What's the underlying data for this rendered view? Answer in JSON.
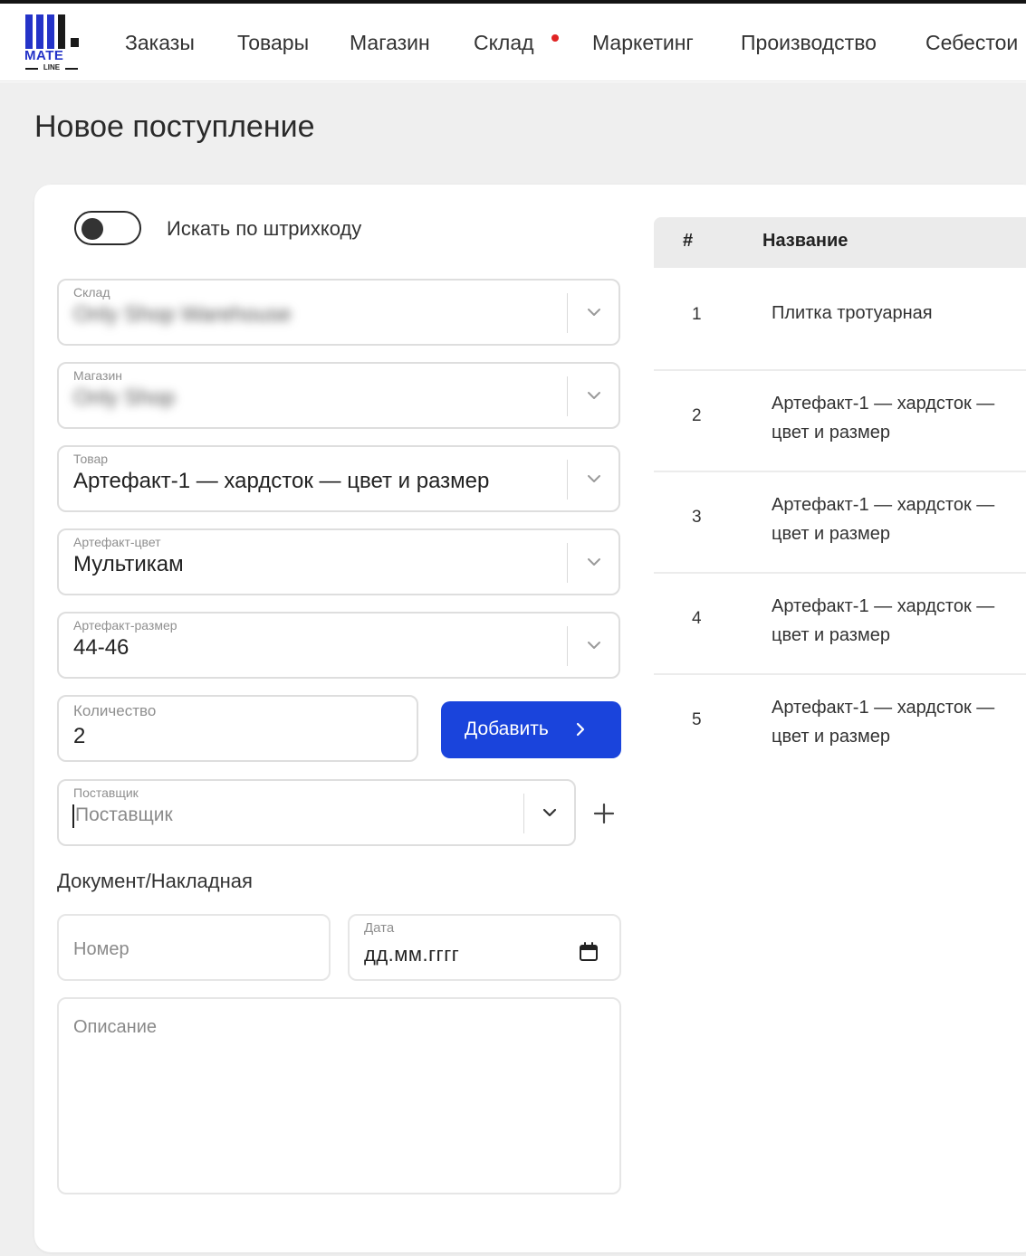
{
  "app": {
    "logo_text": "MATE",
    "logo_subtext": "LINE"
  },
  "nav": {
    "items": [
      {
        "label": "Заказы"
      },
      {
        "label": "Товары"
      },
      {
        "label": "Магазин"
      },
      {
        "label": "Склад",
        "badge": true
      },
      {
        "label": "Маркетинг"
      },
      {
        "label": "Производство"
      },
      {
        "label": "Себестои"
      }
    ]
  },
  "page": {
    "title": "Новое поступление"
  },
  "form": {
    "barcode_toggle": {
      "label": "Искать по штрихкоду",
      "on": false
    },
    "warehouse": {
      "label": "Склад",
      "value": "Only Shop Warehouse"
    },
    "store": {
      "label": "Магазин",
      "value": "Only Shop"
    },
    "product": {
      "label": "Товар",
      "value": "Артефакт-1 — хардсток — цвет и размер"
    },
    "color": {
      "label": "Артефакт-цвет",
      "value": "Мультикам"
    },
    "size": {
      "label": "Артефакт-размер",
      "value": "44-46"
    },
    "quantity": {
      "label": "Количество",
      "value": "2"
    },
    "add_button": {
      "label": "Добавить"
    },
    "supplier": {
      "label": "Поставщик",
      "placeholder": "Поставщик"
    },
    "document_section": "Документ/Накладная",
    "number": {
      "placeholder": "Номер"
    },
    "date": {
      "label": "Дата",
      "placeholder": "дд.мм.гггг"
    },
    "description": {
      "placeholder": "Описание"
    }
  },
  "table": {
    "columns": [
      "#",
      "Название"
    ],
    "rows": [
      {
        "num": "1",
        "name": "Плитка тротуарная"
      },
      {
        "num": "2",
        "name": "Артефакт-1 — хардсток — цвет и размер"
      },
      {
        "num": "3",
        "name": "Артефакт-1 — хардсток — цвет и размер"
      },
      {
        "num": "4",
        "name": "Артефакт-1 — хардсток — цвет и размер"
      },
      {
        "num": "5",
        "name": "Артефакт-1 — хардсток — цвет и размер"
      }
    ]
  },
  "colors": {
    "primary": "#1a44dc",
    "logo_blue": "#2433c8",
    "badge_red": "#e02424"
  }
}
